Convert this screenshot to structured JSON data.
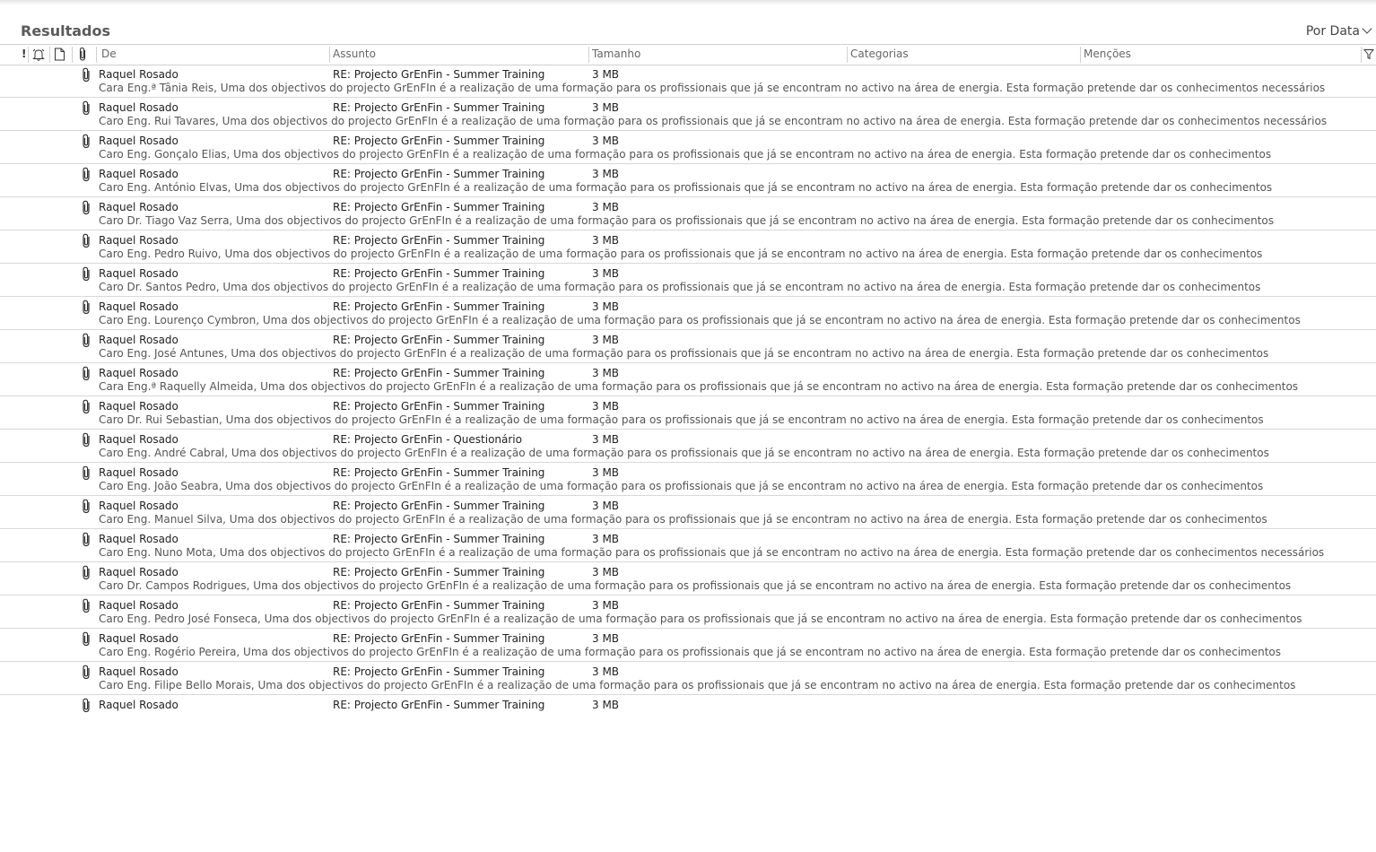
{
  "header": {
    "title": "Resultados",
    "sort_label": "Por Data"
  },
  "columns": {
    "from": "De",
    "subject": "Assunto",
    "size": "Tamanho",
    "categories": "Categorias",
    "mentions": "Menções"
  },
  "icons": {
    "importance": "!",
    "reminder": "reminder-bell-icon",
    "itemtype": "document-icon",
    "attachment": "paperclip-icon",
    "filter": "filter-icon"
  },
  "messages": [
    {
      "from": "Raquel Rosado",
      "subject": "RE: Projecto GrEnFin - Summer Training",
      "size": "3 MB",
      "preview": "Cara Eng.ª Tânia Reis,  Uma dos objectivos do projecto GrEnFIn é a realização de uma formação para os profissionais que já se encontram no activo na área de energia.  Esta formação pretende dar os conhecimentos necessários"
    },
    {
      "from": "Raquel Rosado",
      "subject": "RE: Projecto GrEnFin - Summer Training",
      "size": "3 MB",
      "preview": "Caro Eng. Rui Tavares,  Uma dos objectivos do projecto GrEnFIn é a realização de uma formação para os profissionais que já se encontram no activo na área de energia.  Esta formação pretende dar os conhecimentos necessários"
    },
    {
      "from": "Raquel Rosado",
      "subject": "RE: Projecto GrEnFin - Summer Training",
      "size": "3 MB",
      "preview": "Caro Eng. Gonçalo Elias,  Uma dos objectivos do projecto GrEnFIn é a realização de uma formação para os profissionais que já se encontram no activo na área de energia.  Esta formação pretende dar os conhecimentos"
    },
    {
      "from": "Raquel Rosado",
      "subject": "RE: Projecto GrEnFin - Summer Training",
      "size": "3 MB",
      "preview": "Caro Eng. António Elvas,  Uma dos objectivos do projecto GrEnFIn é a realização de uma formação para os profissionais que já se encontram no activo na área de energia.  Esta formação pretende dar os conhecimentos"
    },
    {
      "from": "Raquel Rosado",
      "subject": "RE: Projecto GrEnFin - Summer Training",
      "size": "3 MB",
      "preview": "Caro Dr. Tiago Vaz Serra,  Uma dos objectivos do projecto GrEnFIn é a realização de uma formação para os profissionais que já se encontram no activo na área de energia.  Esta formação pretende dar os conhecimentos"
    },
    {
      "from": "Raquel Rosado",
      "subject": "RE: Projecto GrEnFin - Summer Training",
      "size": "3 MB",
      "preview": "Caro Eng. Pedro Ruivo,  Uma dos objectivos do projecto GrEnFIn é a realização de uma formação para os profissionais que já se encontram no activo na área de energia.  Esta formação pretende dar os conhecimentos"
    },
    {
      "from": "Raquel Rosado",
      "subject": "RE: Projecto GrEnFin - Summer Training",
      "size": "3 MB",
      "preview": "Caro Dr. Santos Pedro,  Uma dos objectivos do projecto GrEnFIn é a realização de uma formação para os profissionais que já se encontram no activo na área de energia.  Esta formação pretende dar os conhecimentos"
    },
    {
      "from": "Raquel Rosado",
      "subject": "RE: Projecto GrEnFin - Summer Training",
      "size": "3 MB",
      "preview": "Caro Eng. Lourenço Cymbron,  Uma dos objectivos do projecto GrEnFIn é a realização de uma formação para os profissionais que já se encontram no activo na área de energia.  Esta formação pretende dar os conhecimentos"
    },
    {
      "from": "Raquel Rosado",
      "subject": "RE: Projecto GrEnFin - Summer Training",
      "size": "3 MB",
      "preview": "Caro Eng. José Antunes,  Uma dos objectivos do projecto GrEnFIn é a realização de uma formação para os profissionais que já se encontram no activo na área de energia.  Esta formação pretende dar os conhecimentos"
    },
    {
      "from": "Raquel Rosado",
      "subject": "RE: Projecto GrEnFin - Summer Training",
      "size": "3 MB",
      "preview": "Cara Eng.ª Raquelly Almeida,  Uma dos objectivos do projecto GrEnFIn é a realização de uma formação para os profissionais que já se encontram no activo na área de energia.  Esta formação pretende dar os conhecimentos"
    },
    {
      "from": "Raquel Rosado",
      "subject": "RE: Projecto GrEnFin - Summer Training",
      "size": "3 MB",
      "preview": "Caro Dr. Rui Sebastian,  Uma dos objectivos do projecto GrEnFIn é a realização de uma formação para os profissionais que já se encontram no activo na área de energia.  Esta formação pretende dar os conhecimentos"
    },
    {
      "from": "Raquel Rosado",
      "subject": "RE: Projecto GrEnFin - Questionário",
      "size": "3 MB",
      "preview": "Caro Eng. André Cabral,  Uma dos objectivos do projecto GrEnFIn é a realização de uma formação para os profissionais que já se encontram no activo na área de energia.  Esta formação pretende dar os conhecimentos"
    },
    {
      "from": "Raquel Rosado",
      "subject": "RE: Projecto GrEnFin - Summer Training",
      "size": "3 MB",
      "preview": "Caro Eng. João Seabra,  Uma dos objectivos do projecto GrEnFIn é a realização de uma formação para os profissionais que já se encontram no activo na área de energia.  Esta formação pretende dar os conhecimentos"
    },
    {
      "from": "Raquel Rosado",
      "subject": "RE: Projecto GrEnFin - Summer Training",
      "size": "3 MB",
      "preview": "Caro Eng. Manuel Silva,  Uma dos objectivos do projecto GrEnFIn é a realização de uma formação para os profissionais que já se encontram no activo na área de energia.  Esta formação pretende dar os conhecimentos"
    },
    {
      "from": "Raquel Rosado",
      "subject": "RE: Projecto GrEnFin - Summer Training",
      "size": "3 MB",
      "preview": "Caro Eng. Nuno Mota,  Uma dos objectivos do projecto GrEnFIn é a realização de uma formação para os profissionais que já se encontram no activo na área de energia.  Esta formação pretende dar os conhecimentos necessários"
    },
    {
      "from": "Raquel Rosado",
      "subject": "RE: Projecto GrEnFin - Summer Training",
      "size": "3 MB",
      "preview": "Caro Dr. Campos Rodrigues,  Uma dos objectivos do projecto GrEnFIn é a realização de uma formação para os profissionais que já se encontram no activo na área de energia.  Esta formação pretende dar os conhecimentos"
    },
    {
      "from": "Raquel Rosado",
      "subject": "RE: Projecto GrEnFin - Summer Training",
      "size": "3 MB",
      "preview": "Caro Eng. Pedro José Fonseca,  Uma dos objectivos do projecto GrEnFIn é a realização de uma formação para os profissionais que já se encontram no activo na área de energia.  Esta formação pretende dar os conhecimentos"
    },
    {
      "from": "Raquel Rosado",
      "subject": "RE: Projecto GrEnFin - Summer Training",
      "size": "3 MB",
      "preview": "Caro Eng. Rogério Pereira,  Uma dos objectivos do projecto GrEnFIn é a realização de uma formação para os profissionais que já se encontram no activo na área de energia.  Esta formação pretende dar os conhecimentos"
    },
    {
      "from": "Raquel Rosado",
      "subject": "RE: Projecto GrEnFin - Summer Training",
      "size": "3 MB",
      "preview": "Caro Eng. Filipe Bello Morais,  Uma dos objectivos do projecto GrEnFIn é a realização de uma formação para os profissionais que já se encontram no activo na área de energia.  Esta formação pretende dar os conhecimentos"
    },
    {
      "from": "Raquel Rosado",
      "subject": "RE: Projecto GrEnFin - Summer Training",
      "size": "3 MB",
      "preview": ""
    }
  ]
}
